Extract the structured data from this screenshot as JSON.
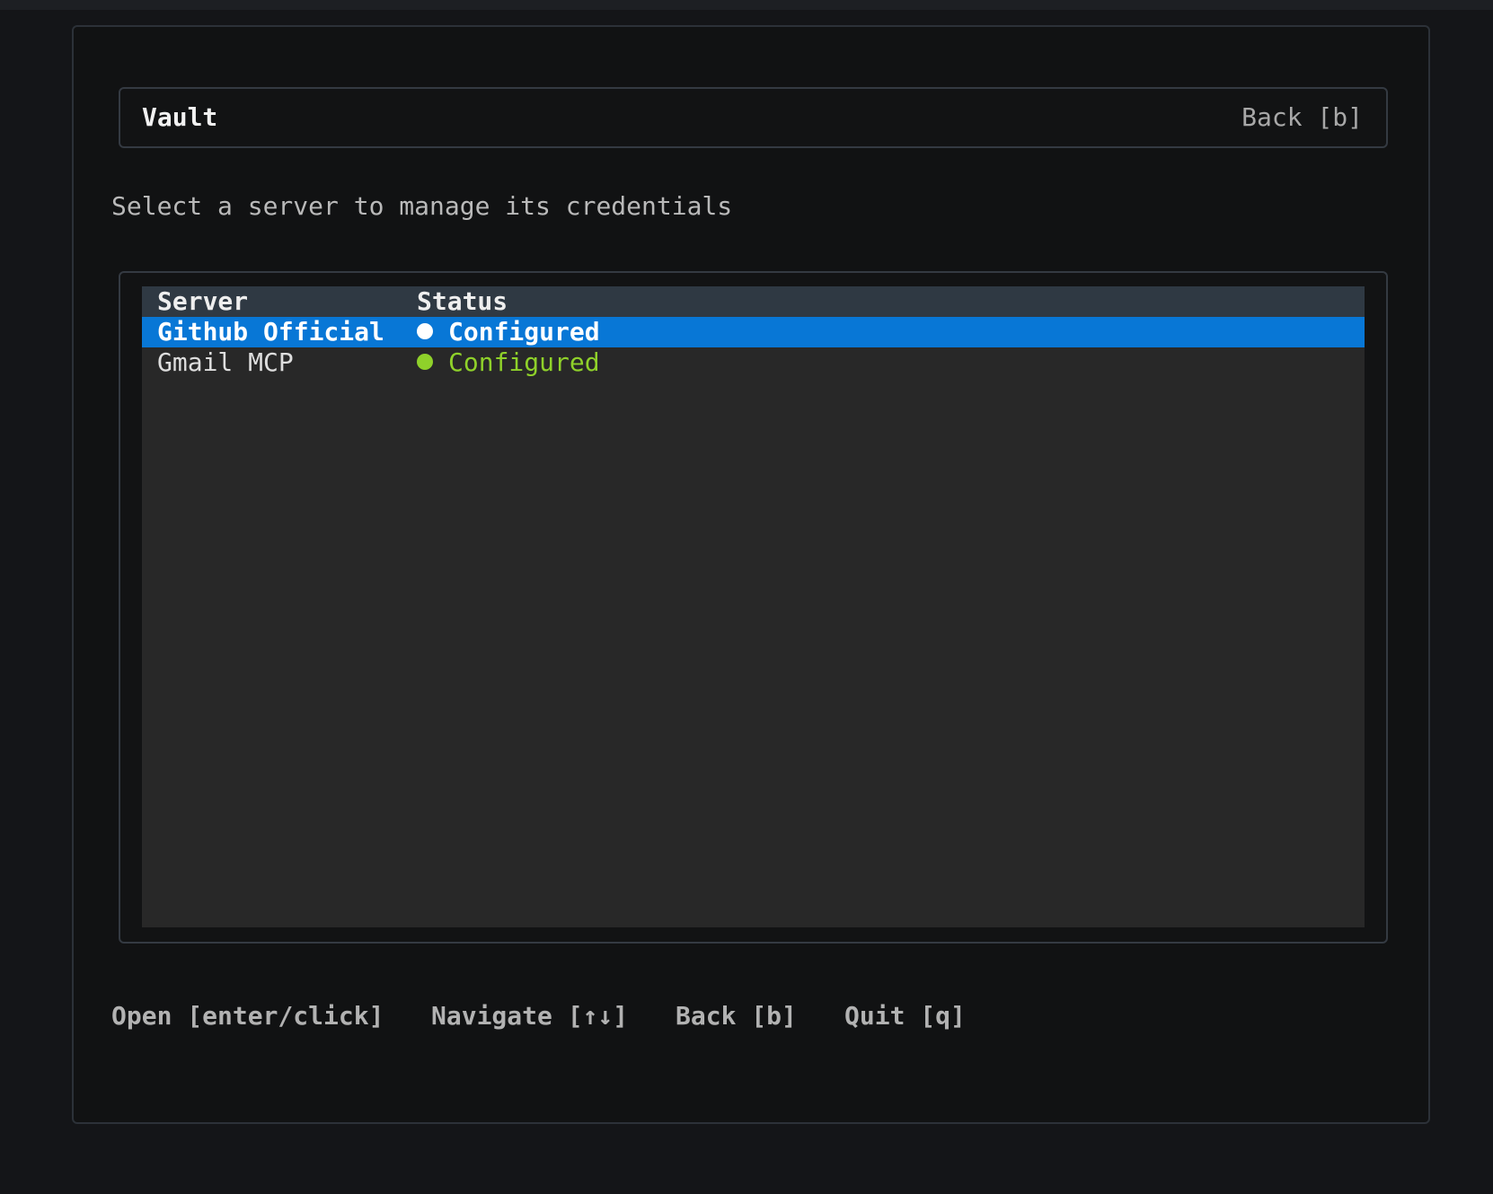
{
  "header": {
    "title": "Vault",
    "back_label": "Back [b]"
  },
  "subtitle": "Select a server to manage its credentials",
  "table": {
    "columns": [
      "Server",
      "Status"
    ],
    "rows": [
      {
        "server": "Github Official",
        "status": "Configured",
        "selected": true
      },
      {
        "server": "Gmail MCP",
        "status": "Configured",
        "selected": false
      }
    ]
  },
  "footer": {
    "open": "Open [enter/click]",
    "navigate": "Navigate [↑↓]",
    "back": "Back [b]",
    "quit": "Quit [q]"
  },
  "colors": {
    "selected_row": "#0877d6",
    "status_configured": "#8fd12a",
    "table_header": "#2f3943",
    "table_bg": "#282828"
  }
}
